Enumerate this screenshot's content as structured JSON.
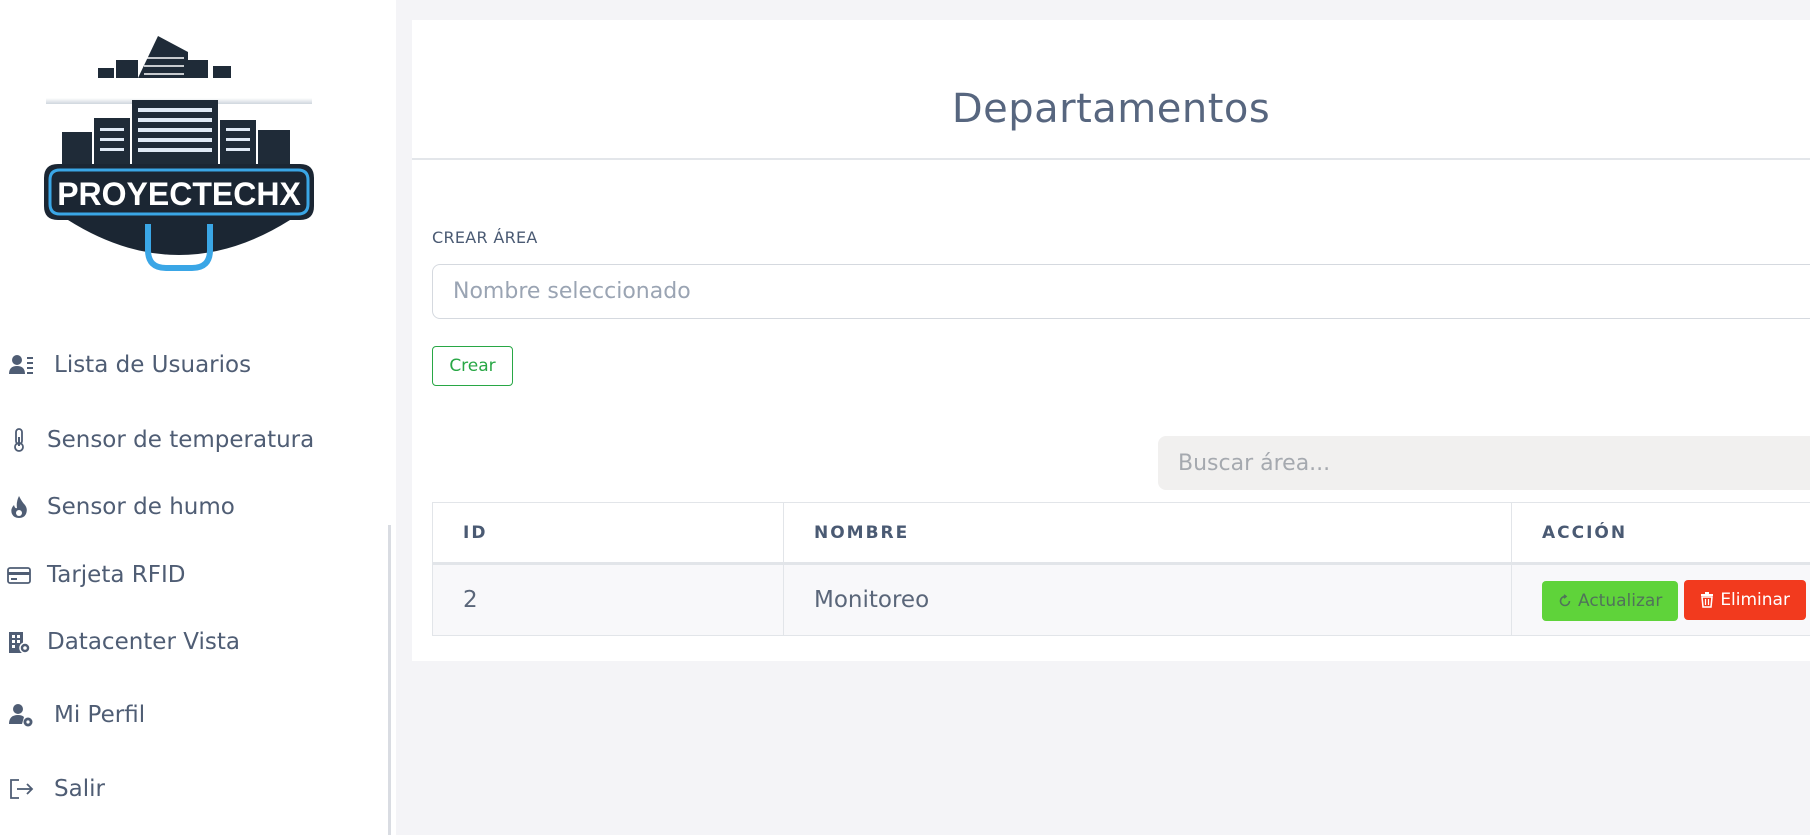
{
  "sidebar": {
    "logo_text": "PROYECTECHX",
    "items": [
      {
        "label": "Lista de Usuarios",
        "icon": "user-list-icon"
      },
      {
        "label": "Sensor de temperatura",
        "icon": "thermometer-icon"
      },
      {
        "label": "Sensor de humo",
        "icon": "fire-icon"
      },
      {
        "label": "Tarjeta RFID",
        "icon": "credit-card-icon"
      },
      {
        "label": "Datacenter Vista",
        "icon": "building-gear-icon"
      },
      {
        "label": "Mi Perfil",
        "icon": "user-gear-icon"
      },
      {
        "label": "Salir",
        "icon": "logout-icon"
      }
    ]
  },
  "main": {
    "title": "Departamentos",
    "form": {
      "label": "CREAR ÁREA",
      "placeholder": "Nombre seleccionado",
      "button": "Crear"
    },
    "search": {
      "placeholder": "Buscar área..."
    },
    "table": {
      "headers": [
        "ID",
        "NOMBRE",
        "ACCIÓN"
      ],
      "rows": [
        {
          "id": "2",
          "nombre": "Monitoreo"
        }
      ],
      "actions": {
        "update": "Actualizar",
        "delete": "Eliminar"
      }
    }
  },
  "colors": {
    "update_button": "#5fd33a",
    "delete_button": "#f23a1e",
    "create_button": "#28a745"
  }
}
